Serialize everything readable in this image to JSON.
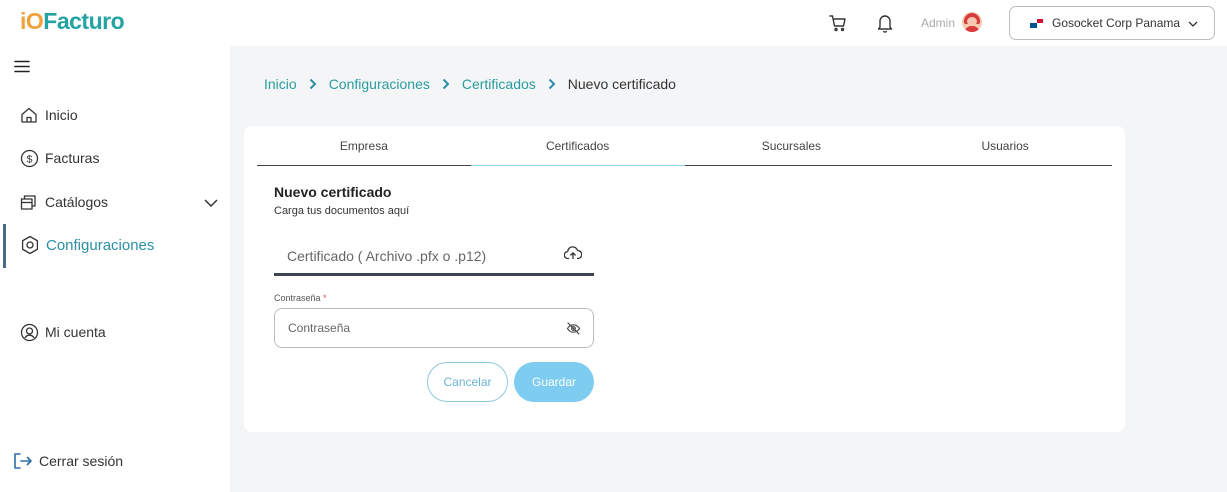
{
  "header": {
    "logo_mark": "iO",
    "logo_text": "Facturo",
    "admin_label": "Admin",
    "company": "Gosocket Corp Panama"
  },
  "sidebar": {
    "items": [
      {
        "label": "Inicio",
        "icon": "home-icon"
      },
      {
        "label": "Facturas",
        "icon": "dollar-circle-icon"
      },
      {
        "label": "Catálogos",
        "icon": "catalog-icon"
      },
      {
        "label": "Configuraciones",
        "icon": "gear-icon"
      },
      {
        "label": "Mi cuenta",
        "icon": "user-circle-icon"
      }
    ],
    "logout": "Cerrar sesión"
  },
  "breadcrumb": [
    "Inicio",
    "Configuraciones",
    "Certificados",
    "Nuevo certificado"
  ],
  "tabs": [
    "Empresa",
    "Certificados",
    "Sucursales",
    "Usuarios"
  ],
  "active_tab": "Certificados",
  "form": {
    "title": "Nuevo certificado",
    "subtitle": "Carga tus documentos aquí",
    "file_placeholder": "Certificado ( Archivo .pfx o .p12)",
    "password_label": "Contraseña",
    "password_required_mark": "*",
    "password_placeholder": "Contraseña",
    "cancel_label": "Cancelar",
    "save_label": "Guardar"
  },
  "colors": {
    "brand_teal": "#23a3a3",
    "logo_accent": "#f0a23a",
    "link": "#2a9d9d",
    "active_nav": "#2a8fa5",
    "save_button": "#7ecdf0",
    "cancel_border": "#8fc7e0",
    "main_background": "#f4f5f7"
  }
}
